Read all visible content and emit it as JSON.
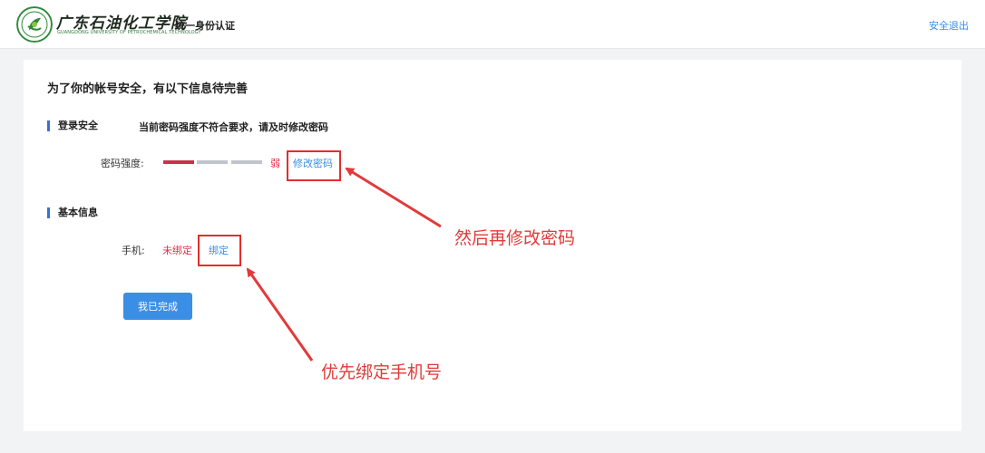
{
  "header": {
    "school_name_cn": "广东石油化工学院",
    "school_name_en": "GUANGDONG UNIVERSITY OF PETROCHEMICAL TECHNOLOGY",
    "title": "统一身份认证",
    "logout": "安全退出"
  },
  "main": {
    "notice": "为了你的帐号安全，有以下信息待完善",
    "login_security": {
      "title": "登录安全",
      "tip": "当前密码强度不符合要求，请及时修改密码",
      "strength_label": "密码强度:",
      "strength_level": 1,
      "strength_max": 3,
      "strength_text": "弱",
      "change_password": "修改密码"
    },
    "basic_info": {
      "title": "基本信息",
      "phone_label": "手机:",
      "phone_status": "未绑定",
      "bind_link": "绑定"
    },
    "done_button": "我已完成"
  },
  "annotations": {
    "step2": "然后再修改密码",
    "step1": "优先绑定手机号",
    "color": "#e23a3a"
  },
  "colors": {
    "accent": "#3a8ee6",
    "weak": "#c8334a",
    "logo_green": "#2f8a3a"
  }
}
